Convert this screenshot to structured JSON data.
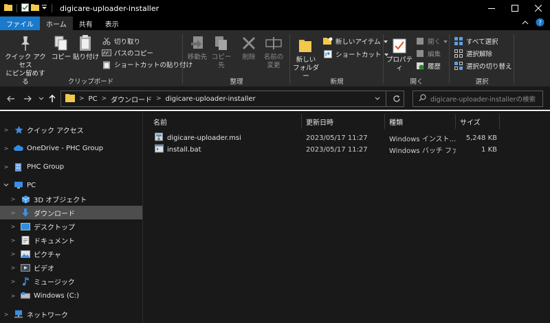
{
  "window": {
    "title": "digicare-uploader-installer"
  },
  "ribbon_tabs": [
    "ファイル",
    "ホーム",
    "共有",
    "表示"
  ],
  "ribbon": {
    "clipboard": {
      "label": "クリップボード",
      "pin_line1": "クイック アクセス",
      "pin_line2": "にピン留めする",
      "copy": "コピー",
      "paste": "貼り付け",
      "cut": "切り取り",
      "copy_path": "パスのコピー",
      "paste_shortcut": "ショートカットの貼り付け"
    },
    "organize": {
      "label": "整理",
      "move_to": "移動先",
      "copy_to": "コピー先",
      "delete": "削除",
      "rename_line1": "名前の",
      "rename_line2": "変更"
    },
    "new": {
      "label": "新規",
      "new_folder_line1": "新しい",
      "new_folder_line2": "フォルダー",
      "new_item": "新しいアイテム",
      "shortcut": "ショートカット"
    },
    "open": {
      "label": "開く",
      "properties": "プロパティ",
      "open": "開く",
      "edit": "編集",
      "history": "履歴"
    },
    "select": {
      "label": "選択",
      "select_all": "すべて選択",
      "select_none": "選択解除",
      "invert": "選択の切り替え"
    }
  },
  "address": {
    "crumbs": [
      "PC",
      "ダウンロード",
      "digicare-uploader-installer"
    ],
    "search_placeholder": "digicare-uploader-installerの検索"
  },
  "nav": {
    "quick_access": "クイック アクセス",
    "onedrive": "OneDrive - PHC Group",
    "phc_group": "PHC Group",
    "pc": "PC",
    "objects3d": "3D オブジェクト",
    "downloads": "ダウンロード",
    "desktop": "デスクトップ",
    "documents": "ドキュメント",
    "pictures": "ピクチャ",
    "videos": "ビデオ",
    "music": "ミュージック",
    "windows_c": "Windows (C:)",
    "network": "ネットワーク"
  },
  "columns": {
    "name": "名前",
    "modified": "更新日時",
    "type": "種類",
    "size": "サイズ"
  },
  "files": [
    {
      "name": "digicare-uploader.msi",
      "modified": "2023/05/17 11:27",
      "type": "Windows インスト...",
      "size": "5,248 KB"
    },
    {
      "name": "install.bat",
      "modified": "2023/05/17 11:27",
      "type": "Windows バッチ ファ...",
      "size": "1 KB"
    }
  ]
}
